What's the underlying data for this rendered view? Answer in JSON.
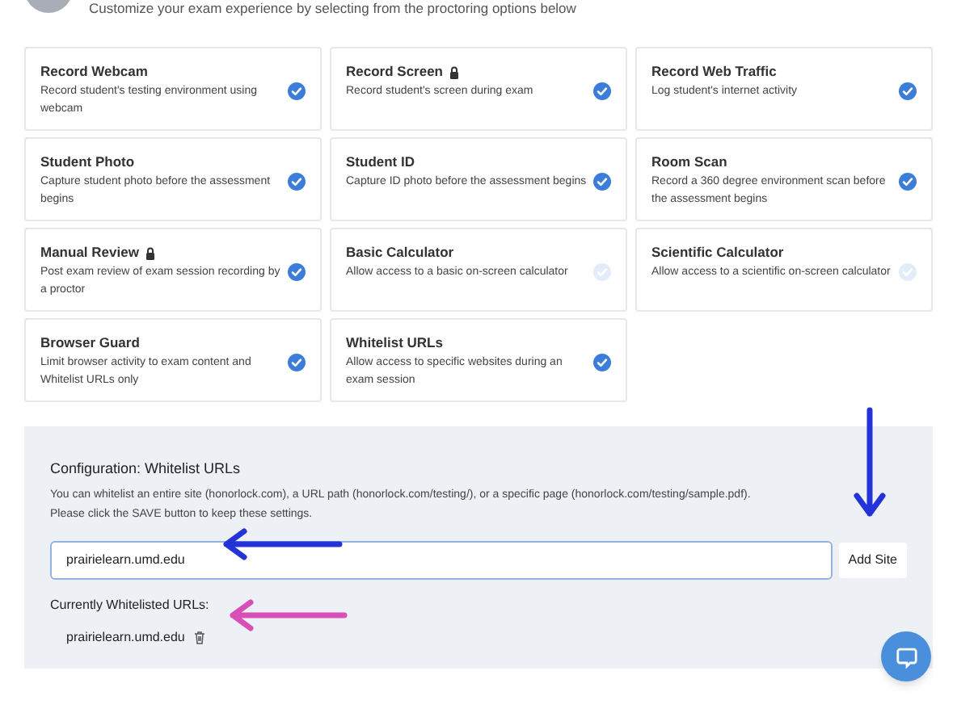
{
  "header": {
    "subtitle": "Customize your exam experience by selecting from the proctoring options below"
  },
  "options": [
    {
      "title": "Record Webcam",
      "description": "Record student's testing environment using webcam",
      "locked": false,
      "checked": true
    },
    {
      "title": "Record Screen",
      "description": "Record student's screen during exam",
      "locked": true,
      "checked": true
    },
    {
      "title": "Record Web Traffic",
      "description": "Log student's internet activity",
      "locked": false,
      "checked": true
    },
    {
      "title": "Student Photo",
      "description": "Capture student photo before the assessment begins",
      "locked": false,
      "checked": true
    },
    {
      "title": "Student ID",
      "description": "Capture ID photo before the assessment begins",
      "locked": false,
      "checked": true
    },
    {
      "title": "Room Scan",
      "description": "Record a 360 degree environment scan before the assessment begins",
      "locked": false,
      "checked": true
    },
    {
      "title": "Manual Review",
      "description": "Post exam review of exam session recording by a proctor",
      "locked": true,
      "checked": true
    },
    {
      "title": "Basic Calculator",
      "description": "Allow access to a basic on-screen calculator",
      "locked": false,
      "checked": false
    },
    {
      "title": "Scientific Calculator",
      "description": "Allow access to a scientific on-screen calculator",
      "locked": false,
      "checked": false
    },
    {
      "title": "Browser Guard",
      "description": "Limit browser activity to exam content and Whitelist URLs only",
      "locked": false,
      "checked": true
    },
    {
      "title": "Whitelist URLs",
      "description": "Allow access to specific websites during an exam session",
      "locked": false,
      "checked": true
    }
  ],
  "configuration": {
    "title": "Configuration: Whitelist URLs",
    "help": "You can whitelist an entire site (honorlock.com), a URL path (honorlock.com/testing/), or a specific page (honorlock.com/testing/sample.pdf).",
    "help_2": "Please click the SAVE button to keep these settings.",
    "url_field": {
      "value": "prairielearn.umd.edu"
    },
    "add_button": "Add Site",
    "list_label": "Currently Whitelisted URLs:",
    "urls": [
      "prairielearn.umd.edu"
    ]
  }
}
